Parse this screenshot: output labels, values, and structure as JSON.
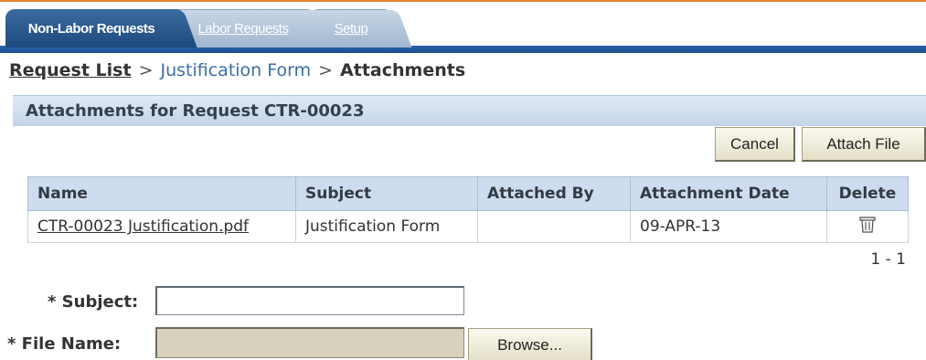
{
  "tabs": [
    {
      "label": "Non-Labor Requests",
      "active": true
    },
    {
      "label": "Labor Requests",
      "active": false
    },
    {
      "label": "Setup",
      "active": false
    }
  ],
  "breadcrumb": {
    "items": [
      "Request List",
      "Justification Form",
      "Attachments"
    ],
    "separator": ">"
  },
  "section": {
    "title": "Attachments for Request CTR-00023"
  },
  "actions": {
    "cancel_label": "Cancel",
    "attach_label": "Attach File"
  },
  "table": {
    "columns": [
      "Name",
      "Subject",
      "Attached By",
      "Attachment Date",
      "Delete"
    ],
    "rows": [
      {
        "name": "CTR-00023 Justification.pdf",
        "subject": "Justification Form",
        "attached_by": "",
        "date": "09-APR-13",
        "delete_icon": "trash-icon"
      }
    ],
    "pager": "1 - 1"
  },
  "form": {
    "subject_label": "* Subject:",
    "subject_value": "",
    "file_label": "* File Name:",
    "file_value": "",
    "browse_label": "Browse..."
  },
  "colors": {
    "accent_orange": "#e9852c",
    "tab_active": "#1f4a7e",
    "header_bg": "#c3d4e8",
    "button_bg": "#e4dfc8"
  }
}
